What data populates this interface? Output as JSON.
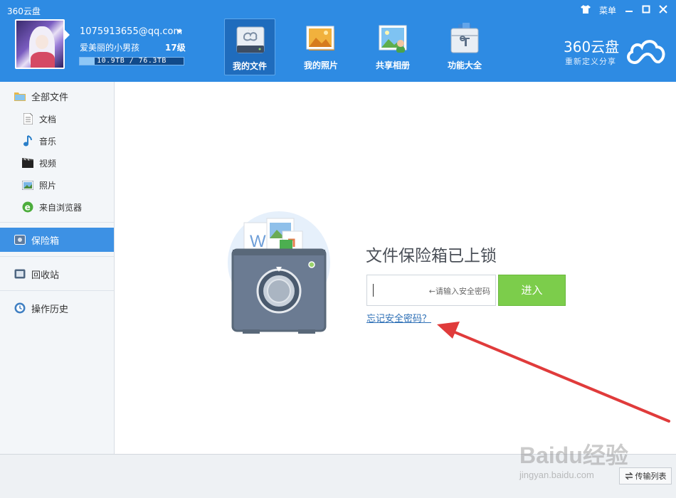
{
  "app": {
    "title": "360云盘",
    "menu_label": "菜单"
  },
  "account": {
    "email": "1075913655@qq.com",
    "nickname": "爱美丽的小男孩",
    "level": "17级",
    "storage_text": "10.9TB / 76.3TB",
    "storage_used_fraction": 0.143
  },
  "nav": {
    "tabs": [
      {
        "label": "我的文件",
        "icon": "files-icon",
        "active": true
      },
      {
        "label": "我的照片",
        "icon": "photos-icon",
        "active": false
      },
      {
        "label": "共享相册",
        "icon": "shared-album-icon",
        "active": false
      },
      {
        "label": "功能大全",
        "icon": "toolbox-icon",
        "active": false
      }
    ]
  },
  "brand": {
    "name": "360云盘",
    "slogan": "重新定义分享"
  },
  "sidebar": {
    "all_files": "全部文件",
    "sub_items": [
      {
        "label": "文档",
        "icon": "document-icon"
      },
      {
        "label": "音乐",
        "icon": "music-icon"
      },
      {
        "label": "视频",
        "icon": "video-icon"
      },
      {
        "label": "照片",
        "icon": "photo-icon"
      },
      {
        "label": "来自浏览器",
        "icon": "browser-icon"
      }
    ],
    "safe_box": "保险箱",
    "recycle_bin": "回收站",
    "history": "操作历史"
  },
  "vault": {
    "title": "文件保险箱已上锁",
    "password_placeholder": "←请输入安全密码",
    "enter_label": "进入",
    "forgot_label": "忘记安全密码？"
  },
  "watermark": {
    "logo": "Baidu经验",
    "url": "jingyan.baidu.com"
  },
  "statusbar": {
    "transfer_label": "传输列表"
  },
  "colors": {
    "header_blue": "#2e8be3",
    "active_tab": "#1f6cbd",
    "sidebar_active": "#3d91e4",
    "enter_green": "#7ccd4b",
    "annotation_red": "#e03b3b"
  }
}
